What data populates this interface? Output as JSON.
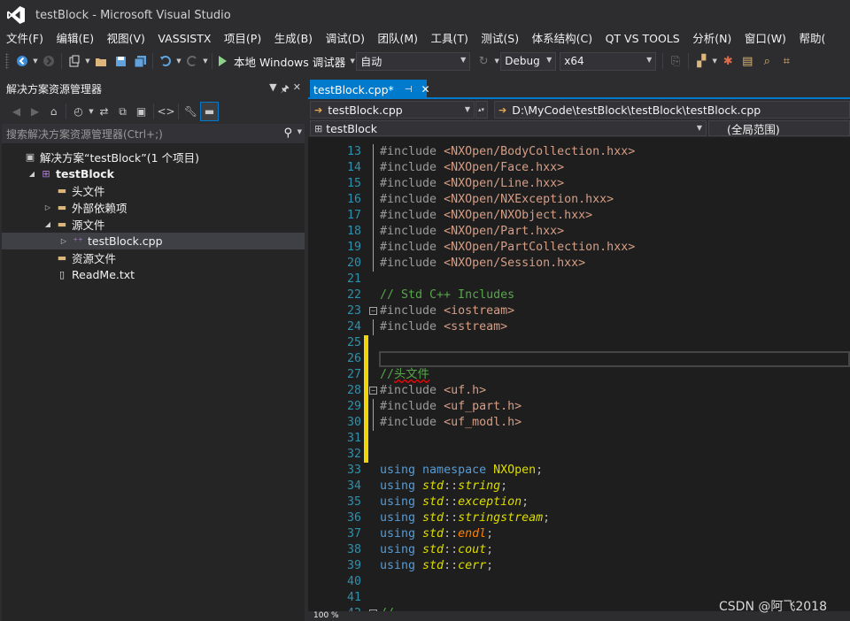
{
  "window": {
    "title": "testBlock - Microsoft Visual Studio"
  },
  "menu": [
    "文件(F)",
    "编辑(E)",
    "视图(V)",
    "VASSISTX",
    "项目(P)",
    "生成(B)",
    "调试(D)",
    "团队(M)",
    "工具(T)",
    "测试(S)",
    "体系结构(C)",
    "QT VS TOOLS",
    "分析(N)",
    "窗口(W)",
    "帮助("
  ],
  "toolbar": {
    "run_label": "本地 Windows 调试器",
    "solution_config": "自动",
    "build_config": "Debug",
    "platform": "x64"
  },
  "solution_explorer": {
    "title": "解决方案资源管理器",
    "search_placeholder": "搜索解决方案资源管理器(Ctrl+;)",
    "tree": [
      {
        "label": "解决方案“testBlock”(1 个项目)",
        "indent": 0,
        "icon": "solution-icon",
        "expand": ""
      },
      {
        "label": "testBlock",
        "indent": 1,
        "icon": "project-icon",
        "expand": "◢",
        "bold": true
      },
      {
        "label": "头文件",
        "indent": 2,
        "icon": "folder-icon",
        "expand": ""
      },
      {
        "label": "外部依赖项",
        "indent": 2,
        "icon": "folder-icon",
        "expand": "▷"
      },
      {
        "label": "源文件",
        "indent": 2,
        "icon": "folder-icon",
        "expand": "◢"
      },
      {
        "label": "testBlock.cpp",
        "indent": 3,
        "icon": "cpp-file-icon",
        "expand": "▷",
        "selected": true
      },
      {
        "label": "资源文件",
        "indent": 2,
        "icon": "folder-icon",
        "expand": ""
      },
      {
        "label": "ReadMe.txt",
        "indent": 2,
        "icon": "text-file-icon",
        "expand": ""
      }
    ]
  },
  "editor": {
    "tab_label": "testBlock.cpp*",
    "nav_file": "testBlock.cpp",
    "nav_path": "D:\\MyCode\\testBlock\\testBlock\\testBlock.cpp",
    "nav_project": "testBlock",
    "nav_scope": "(全局范围)",
    "zoom": "100 %",
    "lines": [
      {
        "n": "13",
        "tokens": [
          [
            "pre",
            "#include "
          ],
          [
            "inc",
            "<NXOpen/BodyCollection.hxx>"
          ]
        ],
        "guide": true
      },
      {
        "n": "14",
        "tokens": [
          [
            "pre",
            "#include "
          ],
          [
            "inc",
            "<NXOpen/Face.hxx>"
          ]
        ],
        "guide": true
      },
      {
        "n": "15",
        "tokens": [
          [
            "pre",
            "#include "
          ],
          [
            "inc",
            "<NXOpen/Line.hxx>"
          ]
        ],
        "guide": true
      },
      {
        "n": "16",
        "tokens": [
          [
            "pre",
            "#include "
          ],
          [
            "inc",
            "<NXOpen/NXException.hxx>"
          ]
        ],
        "guide": true
      },
      {
        "n": "17",
        "tokens": [
          [
            "pre",
            "#include "
          ],
          [
            "inc",
            "<NXOpen/NXObject.hxx>"
          ]
        ],
        "guide": true
      },
      {
        "n": "18",
        "tokens": [
          [
            "pre",
            "#include "
          ],
          [
            "inc",
            "<NXOpen/Part.hxx>"
          ]
        ],
        "guide": true
      },
      {
        "n": "19",
        "tokens": [
          [
            "pre",
            "#include "
          ],
          [
            "inc",
            "<NXOpen/PartCollection.hxx>"
          ]
        ],
        "guide": true
      },
      {
        "n": "20",
        "tokens": [
          [
            "pre",
            "#include "
          ],
          [
            "inc",
            "<NXOpen/Session.hxx>"
          ]
        ],
        "guide": true
      },
      {
        "n": "21",
        "tokens": []
      },
      {
        "n": "22",
        "tokens": [
          [
            "com",
            "// Std C++ Includes"
          ]
        ]
      },
      {
        "n": "23",
        "tokens": [
          [
            "pre",
            "#include "
          ],
          [
            "inc",
            "<iostream>"
          ]
        ],
        "fold": true
      },
      {
        "n": "24",
        "tokens": [
          [
            "pre",
            "#include "
          ],
          [
            "inc",
            "<sstream>"
          ]
        ],
        "guide": true
      },
      {
        "n": "25",
        "tokens": [],
        "changed": true
      },
      {
        "n": "26",
        "tokens": [],
        "changed": true,
        "current": true
      },
      {
        "n": "27",
        "tokens": [
          [
            "com",
            "//"
          ],
          [
            "comsq",
            "头文件"
          ]
        ],
        "changed": true
      },
      {
        "n": "28",
        "tokens": [
          [
            "pre",
            "#include "
          ],
          [
            "inc",
            "<uf.h>"
          ]
        ],
        "fold": true,
        "changed": true
      },
      {
        "n": "29",
        "tokens": [
          [
            "pre",
            "#include "
          ],
          [
            "inc",
            "<uf_part.h>"
          ]
        ],
        "guide": true,
        "changed": true
      },
      {
        "n": "30",
        "tokens": [
          [
            "pre",
            "#include "
          ],
          [
            "inc",
            "<uf_modl.h>"
          ]
        ],
        "guide": true,
        "changed": true
      },
      {
        "n": "31",
        "tokens": [],
        "changed": true
      },
      {
        "n": "32",
        "tokens": [],
        "changed": true
      },
      {
        "n": "33",
        "tokens": [
          [
            "kw",
            "using "
          ],
          [
            "kw",
            "namespace "
          ],
          [
            "nx",
            "NXOpen"
          ],
          [
            "punct",
            ";"
          ]
        ]
      },
      {
        "n": "34",
        "tokens": [
          [
            "kw",
            "using "
          ],
          [
            "typ",
            "std"
          ],
          [
            "punct",
            "::"
          ],
          [
            "typ",
            "string"
          ],
          [
            "punct",
            ";"
          ]
        ]
      },
      {
        "n": "35",
        "tokens": [
          [
            "kw",
            "using "
          ],
          [
            "typ",
            "std"
          ],
          [
            "punct",
            "::"
          ],
          [
            "typ",
            "exception"
          ],
          [
            "punct",
            ";"
          ]
        ]
      },
      {
        "n": "36",
        "tokens": [
          [
            "kw",
            "using "
          ],
          [
            "typ",
            "std"
          ],
          [
            "punct",
            "::"
          ],
          [
            "typ",
            "stringstream"
          ],
          [
            "punct",
            ";"
          ]
        ]
      },
      {
        "n": "37",
        "tokens": [
          [
            "kw",
            "using "
          ],
          [
            "typ",
            "std"
          ],
          [
            "punct",
            "::"
          ],
          [
            "fn",
            "endl"
          ],
          [
            "punct",
            ";"
          ]
        ]
      },
      {
        "n": "38",
        "tokens": [
          [
            "kw",
            "using "
          ],
          [
            "typ",
            "std"
          ],
          [
            "punct",
            "::"
          ],
          [
            "typ",
            "cout"
          ],
          [
            "punct",
            ";"
          ]
        ]
      },
      {
        "n": "39",
        "tokens": [
          [
            "kw",
            "using "
          ],
          [
            "typ",
            "std"
          ],
          [
            "punct",
            "::"
          ],
          [
            "typ",
            "cerr"
          ],
          [
            "punct",
            ";"
          ]
        ]
      },
      {
        "n": "40",
        "tokens": []
      },
      {
        "n": "41",
        "tokens": []
      },
      {
        "n": "42",
        "tokens": [
          [
            "com",
            "//"
          ]
        ],
        "fold": true
      }
    ]
  },
  "watermark": "CSDN @阿飞2018"
}
